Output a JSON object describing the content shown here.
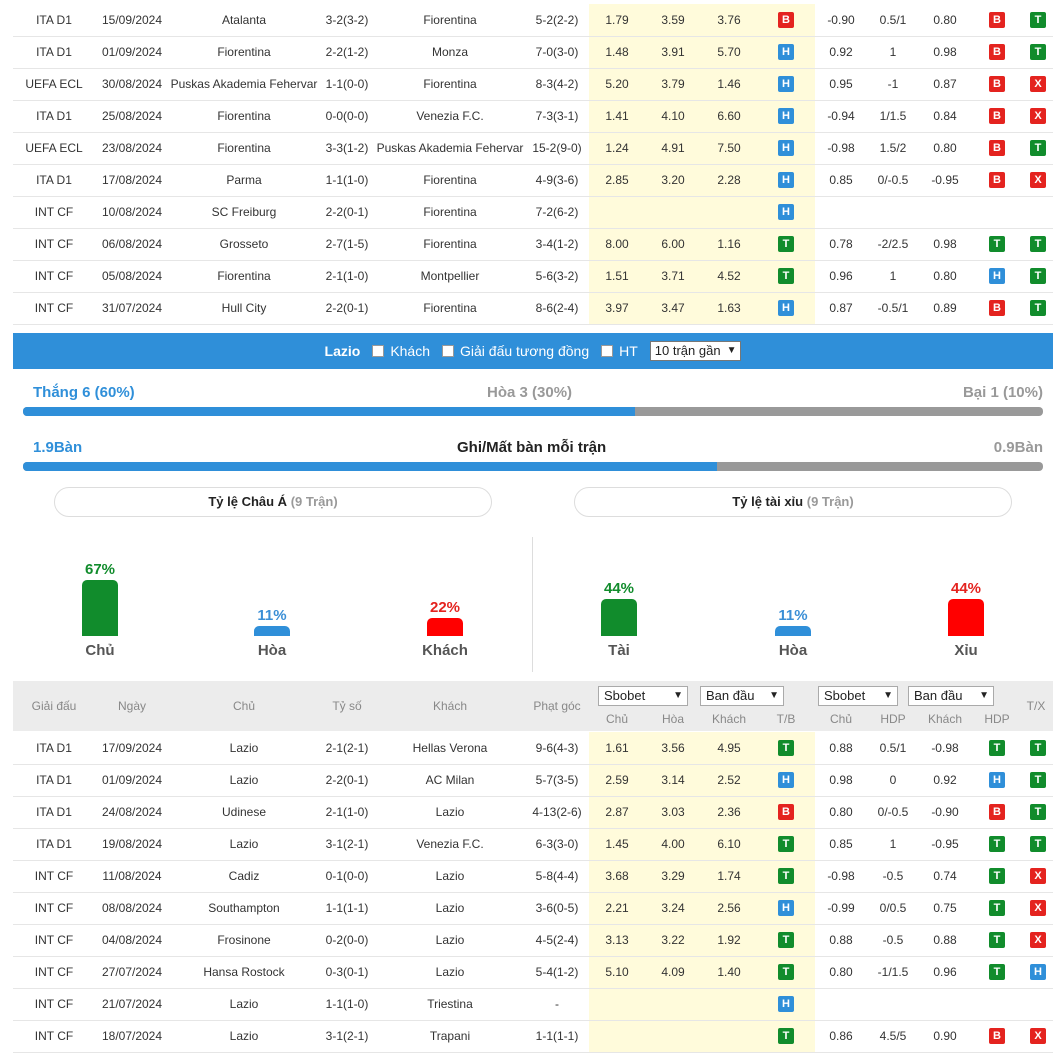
{
  "top_rows": [
    {
      "league": "ITA D1",
      "date": "15/09/2024",
      "home": "Atalanta",
      "home_c": "",
      "score": "3-2(3-2)",
      "score_c": "red",
      "away": "Fiorentina",
      "away_c": "orange",
      "corner": "5-2(2-2)",
      "o1": "1.79",
      "o2": "3.59",
      "o3": "3.76",
      "r1": "B",
      "h1": "-0.90",
      "h2": "0.5/1",
      "h3": "0.80",
      "r2": "B",
      "r3": "T"
    },
    {
      "league": "ITA D1",
      "date": "01/09/2024",
      "home": "Fiorentina",
      "home_c": "orange",
      "score": "2-2(1-2)",
      "score_c": "red",
      "away": "Monza",
      "away_c": "",
      "corner": "7-0(3-0)",
      "o1": "1.48",
      "o2": "3.91",
      "o3": "5.70",
      "r1": "H",
      "h1": "0.92",
      "h2": "1",
      "h3": "0.98",
      "r2": "B",
      "r3": "T"
    },
    {
      "league": "UEFA ECL",
      "date": "30/08/2024",
      "home": "Puskas Akademia Fehervar",
      "home_c": "",
      "score": "1-1(0-0)",
      "score_c": "red",
      "away": "Fiorentina",
      "away_c": "orange",
      "corner": "8-3(4-2)",
      "o1": "5.20",
      "o2": "3.79",
      "o3": "1.46",
      "r1": "H",
      "h1": "0.95",
      "h2": "-1",
      "h3": "0.87",
      "r2": "B",
      "r3": "X"
    },
    {
      "league": "ITA D1",
      "date": "25/08/2024",
      "home": "Fiorentina",
      "home_c": "orange",
      "score": "0-0(0-0)",
      "score_c": "red",
      "away": "Venezia F.C.",
      "away_c": "",
      "corner": "7-3(3-1)",
      "o1": "1.41",
      "o2": "4.10",
      "o3": "6.60",
      "r1": "H",
      "h1": "-0.94",
      "h2": "1/1.5",
      "h3": "0.84",
      "r2": "B",
      "r3": "X"
    },
    {
      "league": "UEFA ECL",
      "date": "23/08/2024",
      "home": "Fiorentina",
      "home_c": "orange",
      "score": "3-3(1-2)",
      "score_c": "red",
      "away": "Puskas Akademia Fehervar",
      "away_c": "",
      "corner": "15-2(9-0)",
      "o1": "1.24",
      "o2": "4.91",
      "o3": "7.50",
      "r1": "H",
      "h1": "-0.98",
      "h2": "1.5/2",
      "h3": "0.80",
      "r2": "B",
      "r3": "T"
    },
    {
      "league": "ITA D1",
      "date": "17/08/2024",
      "home": "Parma",
      "home_c": "",
      "score": "1-1(1-0)",
      "score_c": "red",
      "away": "Fiorentina",
      "away_c": "orange",
      "corner": "4-9(3-6)",
      "o1": "2.85",
      "o2": "3.20",
      "o3": "2.28",
      "r1": "H",
      "h1": "0.85",
      "h2": "0/-0.5",
      "h3": "-0.95",
      "r2": "B",
      "r3": "X"
    },
    {
      "league": "INT CF",
      "date": "10/08/2024",
      "home": "SC Freiburg",
      "home_c": "",
      "score": "2-2(0-1)",
      "score_c": "red",
      "away": "Fiorentina",
      "away_c": "orange",
      "corner": "7-2(6-2)",
      "o1": "",
      "o2": "",
      "o3": "",
      "r1": "H",
      "h1": "",
      "h2": "",
      "h3": "",
      "r2": "",
      "r3": ""
    },
    {
      "league": "INT CF",
      "date": "06/08/2024",
      "home": "Grosseto",
      "home_c": "",
      "score": "2-7(1-5)",
      "score_c": "red",
      "away": "Fiorentina",
      "away_c": "orange",
      "corner": "3-4(1-2)",
      "o1": "8.00",
      "o2": "6.00",
      "o3": "1.16",
      "r1": "T",
      "h1": "0.78",
      "h2": "-2/2.5",
      "h3": "0.98",
      "r2": "T",
      "r3": "T"
    },
    {
      "league": "INT CF",
      "date": "05/08/2024",
      "home": "Fiorentina",
      "home_c": "orange",
      "score": "2-1(1-0)",
      "score_c": "red",
      "away": "Montpellier",
      "away_c": "",
      "corner": "5-6(3-2)",
      "o1": "1.51",
      "o2": "3.71",
      "o3": "4.52",
      "r1": "T",
      "h1": "0.96",
      "h2": "1",
      "h3": "0.80",
      "r2": "H",
      "r3": "T"
    },
    {
      "league": "INT CF",
      "date": "31/07/2024",
      "home": "Hull City",
      "home_c": "",
      "score": "2-2(0-1)",
      "score_c": "red",
      "away": "Fiorentina",
      "away_c": "orange",
      "corner": "8-6(2-4)",
      "o1": "3.97",
      "o2": "3.47",
      "o3": "1.63",
      "r1": "H",
      "h1": "0.87",
      "h2": "-0.5/1",
      "h3": "0.89",
      "r2": "B",
      "r3": "T"
    }
  ],
  "filter": {
    "team": "Lazio",
    "away_label": "Khách",
    "same_league_label": "Giải đấu tương đồng",
    "ht_label": "HT",
    "recent_select": "10 trận gần"
  },
  "summary": {
    "win": "Thắng 6 (60%)",
    "draw": "Hòa 3 (30%)",
    "loss": "Bại 1 (10%)",
    "win_fraction": 0.6,
    "goals_for": "1.9Bàn",
    "goals_title": "Ghi/Mất bàn mỗi trận",
    "goals_against": "0.9Bàn",
    "goals_fraction": 0.68
  },
  "asian": {
    "title": "Tỷ lệ Châu Á",
    "count": "(9 Trận)",
    "items": [
      {
        "pct": "67%",
        "label": "Chủ",
        "value": 67,
        "color": "#118c2c"
      },
      {
        "pct": "11%",
        "label": "Hòa",
        "value": 11,
        "color": "#2f8fd9"
      },
      {
        "pct": "22%",
        "label": "Khách",
        "value": 22,
        "color": "#ff0000"
      }
    ]
  },
  "ou": {
    "title": "Tỷ lệ tài xỉu",
    "count": "(9 Trận)",
    "items": [
      {
        "pct": "44%",
        "label": "Tài",
        "value": 44,
        "color": "#118c2c"
      },
      {
        "pct": "11%",
        "label": "Hòa",
        "value": 11,
        "color": "#2f8fd9"
      },
      {
        "pct": "44%",
        "label": "Xỉu",
        "value": 44,
        "color": "#ff0000"
      }
    ]
  },
  "header": {
    "league": "Giải đấu",
    "date": "Ngày",
    "home": "Chủ",
    "score": "Tỷ số",
    "away": "Khách",
    "corner": "Phạt góc",
    "book1": "Sbobet",
    "type1": "Ban đầu",
    "book2": "Sbobet",
    "type2": "Ban đầu",
    "c_home": "Chủ",
    "c_draw": "Hòa",
    "c_away": "Khách",
    "c_tb": "T/B",
    "c_home2": "Chủ",
    "c_hdp": "HDP",
    "c_away2": "Khách",
    "c_hdp2": "HDP",
    "c_tx": "T/X"
  },
  "bottom_rows": [
    {
      "league": "ITA D1",
      "date": "17/09/2024",
      "home": "Lazio",
      "home_c": "blue",
      "score": "2-1(2-1)",
      "score_c": "red",
      "away": "Hellas Verona",
      "away_c": "",
      "corner": "9-6(4-3)",
      "o1": "1.61",
      "o2": "3.56",
      "o3": "4.95",
      "r1": "T",
      "h1": "0.88",
      "h2": "0.5/1",
      "h3": "-0.98",
      "r2": "T",
      "r3": "T"
    },
    {
      "league": "ITA D1",
      "date": "01/09/2024",
      "home": "Lazio",
      "home_c": "blue",
      "score": "2-2(0-1)",
      "score_c": "red",
      "away": "AC Milan",
      "away_c": "",
      "corner": "5-7(3-5)",
      "o1": "2.59",
      "o2": "3.14",
      "o3": "2.52",
      "r1": "H",
      "h1": "0.98",
      "h2": "0",
      "h3": "0.92",
      "r2": "H",
      "r3": "T"
    },
    {
      "league": "ITA D1",
      "date": "24/08/2024",
      "home": "Udinese",
      "home_c": "",
      "score": "2-1(1-0)",
      "score_c": "red",
      "away": "Lazio",
      "away_c": "blue",
      "corner": "4-13(2-6)",
      "o1": "2.87",
      "o2": "3.03",
      "o3": "2.36",
      "r1": "B",
      "h1": "0.80",
      "h2": "0/-0.5",
      "h3": "-0.90",
      "r2": "B",
      "r3": "T"
    },
    {
      "league": "ITA D1",
      "date": "19/08/2024",
      "home": "Lazio",
      "home_c": "blue",
      "score": "3-1(2-1)",
      "score_c": "red",
      "away": "Venezia F.C.",
      "away_c": "",
      "corner": "6-3(3-0)",
      "o1": "1.45",
      "o2": "4.00",
      "o3": "6.10",
      "r1": "T",
      "h1": "0.85",
      "h2": "1",
      "h3": "-0.95",
      "r2": "T",
      "r3": "T"
    },
    {
      "league": "INT CF",
      "date": "11/08/2024",
      "home": "Cadiz",
      "home_c": "",
      "score": "0-1(0-0)",
      "score_c": "red",
      "away": "Lazio",
      "away_c": "blue",
      "corner": "5-8(4-4)",
      "o1": "3.68",
      "o2": "3.29",
      "o3": "1.74",
      "r1": "T",
      "h1": "-0.98",
      "h2": "-0.5",
      "h3": "0.74",
      "r2": "T",
      "r3": "X"
    },
    {
      "league": "INT CF",
      "date": "08/08/2024",
      "home": "Southampton",
      "home_c": "",
      "score": "1-1(1-1)",
      "score_c": "red",
      "away": "Lazio",
      "away_c": "blue",
      "corner": "3-6(0-5)",
      "o1": "2.21",
      "o2": "3.24",
      "o3": "2.56",
      "r1": "H",
      "h1": "-0.99",
      "h2": "0/0.5",
      "h3": "0.75",
      "r2": "T",
      "r3": "X"
    },
    {
      "league": "INT CF",
      "date": "04/08/2024",
      "home": "Frosinone",
      "home_c": "",
      "score": "0-2(0-0)",
      "score_c": "red",
      "away": "Lazio",
      "away_c": "blue",
      "corner": "4-5(2-4)",
      "o1": "3.13",
      "o2": "3.22",
      "o3": "1.92",
      "r1": "T",
      "h1": "0.88",
      "h2": "-0.5",
      "h3": "0.88",
      "r2": "T",
      "r3": "X"
    },
    {
      "league": "INT CF",
      "date": "27/07/2024",
      "home": "Hansa Rostock",
      "home_c": "",
      "score": "0-3(0-1)",
      "score_c": "red",
      "away": "Lazio",
      "away_c": "blue",
      "corner": "5-4(1-2)",
      "o1": "5.10",
      "o2": "4.09",
      "o3": "1.40",
      "r1": "T",
      "h1": "0.80",
      "h2": "-1/1.5",
      "h3": "0.96",
      "r2": "T",
      "r3": "H"
    },
    {
      "league": "INT CF",
      "date": "21/07/2024",
      "home": "Lazio",
      "home_c": "blue",
      "score": "1-1(1-0)",
      "score_c": "red",
      "away": "Triestina",
      "away_c": "",
      "corner": "-",
      "o1": "",
      "o2": "",
      "o3": "",
      "r1": "H",
      "h1": "",
      "h2": "",
      "h3": "",
      "r2": "",
      "r3": ""
    },
    {
      "league": "INT CF",
      "date": "18/07/2024",
      "home": "Lazio",
      "home_c": "blue",
      "score": "3-1(2-1)",
      "score_c": "red",
      "away": "Trapani",
      "away_c": "",
      "corner": "1-1(1-1)",
      "o1": "",
      "o2": "",
      "o3": "",
      "r1": "T",
      "h1": "0.86",
      "h2": "4.5/5",
      "h3": "0.90",
      "r2": "B",
      "r3": "X"
    }
  ]
}
